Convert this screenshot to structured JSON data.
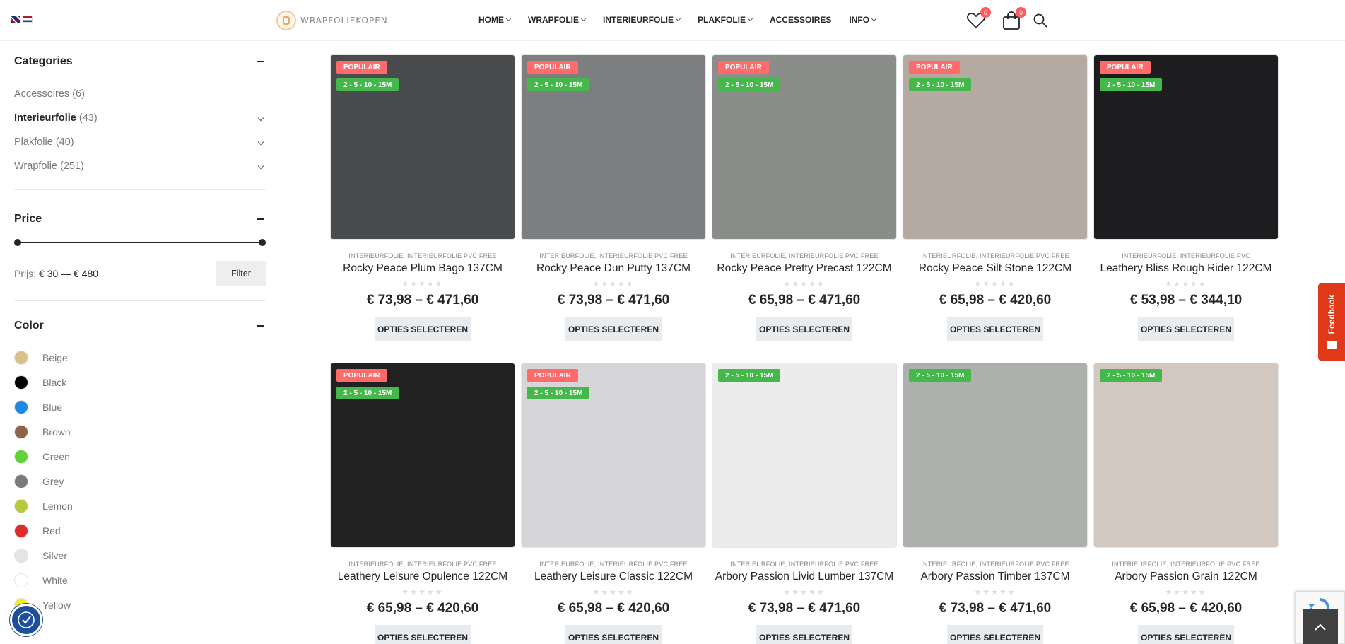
{
  "header": {
    "logo_text": "WRAPFOLIEKOPEN.",
    "nav": [
      {
        "label": "HOME",
        "caret": true
      },
      {
        "label": "WRAPFOLIE",
        "caret": true
      },
      {
        "label": "INTERIEURFOLIE",
        "caret": true
      },
      {
        "label": "PLAKFOLIE",
        "caret": true
      },
      {
        "label": "ACCESSOIRES",
        "caret": false
      },
      {
        "label": "INFO",
        "caret": true
      }
    ],
    "wishlist_count": "0",
    "cart_count": "0"
  },
  "sidebar": {
    "categories_title": "Categories",
    "categories": [
      {
        "name": "Accessoires",
        "count": "(6)",
        "expandable": false,
        "active": false
      },
      {
        "name": "Interieurfolie",
        "count": "(43)",
        "expandable": true,
        "active": true
      },
      {
        "name": "Plakfolie",
        "count": "(40)",
        "expandable": true,
        "active": false
      },
      {
        "name": "Wrapfolie",
        "count": "(251)",
        "expandable": true,
        "active": false
      }
    ],
    "price_title": "Price",
    "price_prefix": "Prijs:",
    "price_range": "€ 30 — € 480",
    "filter_label": "Filter",
    "color_title": "Color",
    "colors": [
      {
        "name": "Beige",
        "hex": "#d8c18c"
      },
      {
        "name": "Black",
        "hex": "#000000"
      },
      {
        "name": "Blue",
        "hex": "#1e88e5"
      },
      {
        "name": "Brown",
        "hex": "#8d6448"
      },
      {
        "name": "Green",
        "hex": "#5fd23a"
      },
      {
        "name": "Grey",
        "hex": "#7a7a7a"
      },
      {
        "name": "Lemon",
        "hex": "#b5c93a"
      },
      {
        "name": "Red",
        "hex": "#e02b2b"
      },
      {
        "name": "Silver",
        "hex": "#e4e4e4"
      },
      {
        "name": "White",
        "hex": "#ffffff"
      },
      {
        "name": "Yellow",
        "hex": "#f4f018"
      }
    ]
  },
  "products": [
    {
      "title": "Rocky Peace Plum Bago 137CM",
      "cats": "INTERIEURFOLIE, INTERIEURFOLIE PVC FREE",
      "price": "€ 73,98 – € 471,60",
      "popular": "POPULAIR",
      "lengths": "2 - 5 - 10 - 15M",
      "color": "#4a4b4d"
    },
    {
      "title": "Rocky Peace Dun Putty 137CM",
      "cats": "INTERIEURFOLIE, INTERIEURFOLIE PVC FREE",
      "price": "€ 73,98 – € 471,60",
      "popular": "POPULAIR",
      "lengths": "2 - 5 - 10 - 15M",
      "color": "#7d7e80"
    },
    {
      "title": "Rocky Peace Pretty Precast 122CM",
      "cats": "INTERIEURFOLIE, INTERIEURFOLIE PVC FREE",
      "price": "€ 65,98 – € 471,60",
      "popular": "POPULAIR",
      "lengths": "2 - 5 - 10 - 15M",
      "color": "#8a8d89"
    },
    {
      "title": "Rocky Peace Silt Stone 122CM",
      "cats": "INTERIEURFOLIE, INTERIEURFOLIE PVC FREE",
      "price": "€ 65,98 – € 420,60",
      "popular": "POPULAIR",
      "lengths": "2 - 5 - 10 - 15M",
      "color": "#b4aaa2"
    },
    {
      "title": "Leathery Bliss Rough Rider 122CM",
      "cats": "INTERIEURFOLIE, INTERIEURFOLIE PVC",
      "price": "€ 53,98 – € 344,10",
      "popular": "POPULAIR",
      "lengths": "2 - 5 - 10 - 15M",
      "color": "#1d1d1f"
    },
    {
      "title": "Leathery Leisure Opulence 122CM",
      "cats": "INTERIEURFOLIE, INTERIEURFOLIE PVC FREE",
      "price": "€ 65,98 – € 420,60",
      "popular": "POPULAIR",
      "lengths": "2 - 5 - 10 - 15M",
      "color": "#212121"
    },
    {
      "title": "Leathery Leisure Classic 122CM",
      "cats": "INTERIEURFOLIE, INTERIEURFOLIE PVC FREE",
      "price": "€ 65,98 – € 420,60",
      "popular": "POPULAIR",
      "lengths": "2 - 5 - 10 - 15M",
      "color": "#d6d6d8"
    },
    {
      "title": "Arbory Passion Livid Lumber 137CM",
      "cats": "INTERIEURFOLIE, INTERIEURFOLIE PVC FREE",
      "price": "€ 73,98 – € 471,60",
      "popular": "",
      "lengths": "2 - 5 - 10 - 15M",
      "color": "#ebeceb"
    },
    {
      "title": "Arbory Passion Timber 137CM",
      "cats": "INTERIEURFOLIE, INTERIEURFOLIE PVC FREE",
      "price": "€ 73,98 – € 471,60",
      "popular": "",
      "lengths": "2 - 5 - 10 - 15M",
      "color": "#aeb0ae"
    },
    {
      "title": "Arbory Passion Grain 122CM",
      "cats": "INTERIEURFOLIE, INTERIEURFOLIE PVC FREE",
      "price": "€ 65,98 – € 420,60",
      "popular": "",
      "lengths": "2 - 5 - 10 - 15M",
      "color": "#d3c8c0"
    }
  ],
  "product_button_label": "OPTIES SELECTEREN",
  "rating_stars": "★★★★★",
  "feedback_label": "Feedback"
}
